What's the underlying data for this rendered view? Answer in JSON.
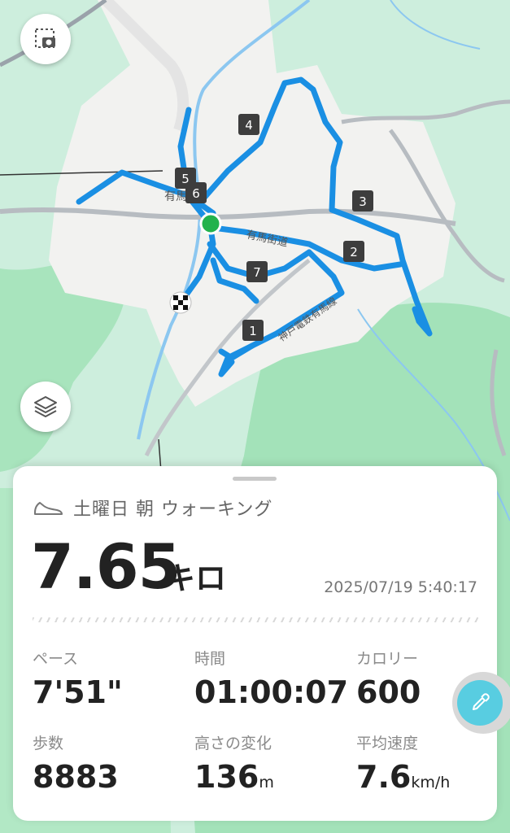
{
  "map": {
    "labels": {
      "town": "有馬町",
      "road": "有馬街道",
      "rail": "神戸電鉄有馬線"
    },
    "markers": [
      "1",
      "2",
      "3",
      "4",
      "5",
      "6",
      "7"
    ],
    "colors": {
      "route": "#1a8fe3",
      "start": "#22b24c",
      "forest": "#9fe0b4",
      "land": "#cdeedd",
      "urban": "#f2f2f0"
    }
  },
  "buttons": {
    "screenshot_icon": "screenshot-icon",
    "layers_icon": "layers-icon",
    "edit_icon": "dropper-icon"
  },
  "activity": {
    "icon": "shoe-icon",
    "title": "土曜日 朝 ウォーキング",
    "distance": "7.65",
    "distance_unit": "キロ",
    "datetime": "2025/07/19 5:40:17"
  },
  "stats": {
    "pace": {
      "label": "ペース",
      "value": "7'51\""
    },
    "time": {
      "label": "時間",
      "value": "01:00:07"
    },
    "calories": {
      "label": "カロリー",
      "value": "600"
    },
    "steps": {
      "label": "歩数",
      "value": "8883"
    },
    "elevation": {
      "label": "高さの変化",
      "value": "136",
      "unit": "m"
    },
    "avg_speed": {
      "label": "平均速度",
      "value": "7.6",
      "unit": "km/h"
    }
  }
}
